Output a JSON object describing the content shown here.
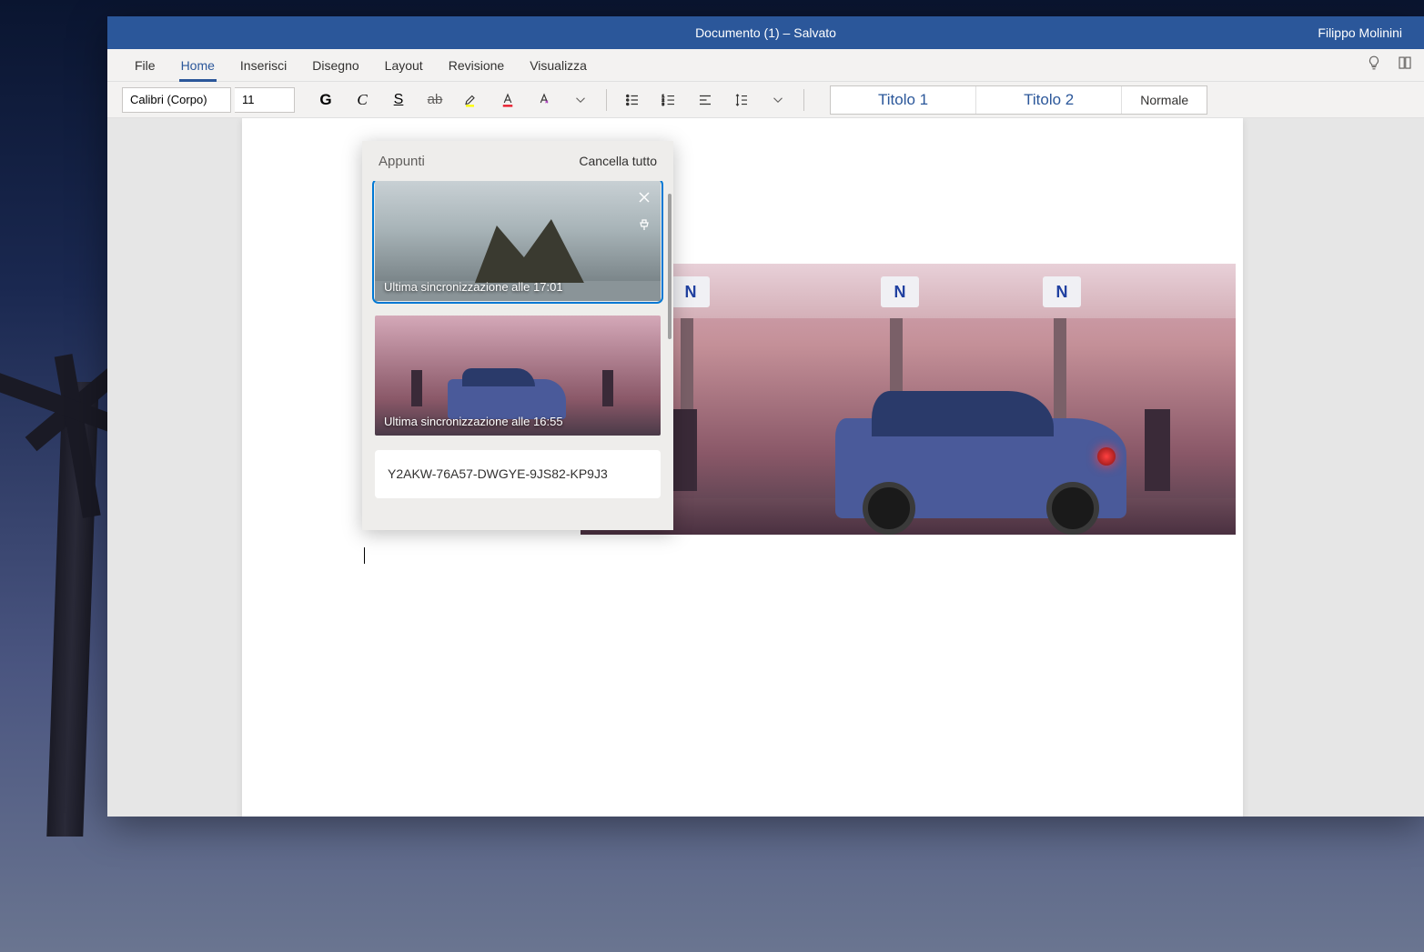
{
  "titlebar": {
    "title": "Documento (1) – Salvato",
    "user": "Filippo Molinini"
  },
  "ribbon": {
    "tabs": [
      "File",
      "Home",
      "Inserisci",
      "Disegno",
      "Layout",
      "Revisione",
      "Visualizza"
    ],
    "active_index": 1
  },
  "toolbar": {
    "font_name": "Calibri (Corpo)",
    "font_size": "11",
    "bold": "G",
    "italic": "C",
    "underline": "S"
  },
  "styles": {
    "heading1": "Titolo 1",
    "heading2": "Titolo 2",
    "normal": "Normale"
  },
  "clipboard": {
    "title": "Appunti",
    "clear_all": "Cancella tutto",
    "items": [
      {
        "type": "image",
        "caption": "Ultima sincronizzazione alle 17:01",
        "selected": true
      },
      {
        "type": "image",
        "caption": "Ultima sincronizzazione alle 16:55",
        "selected": false
      },
      {
        "type": "text",
        "content": "Y2AKW-76A57-DWGYE-9JS82-KP9J3"
      }
    ]
  },
  "gas_sign": "N"
}
